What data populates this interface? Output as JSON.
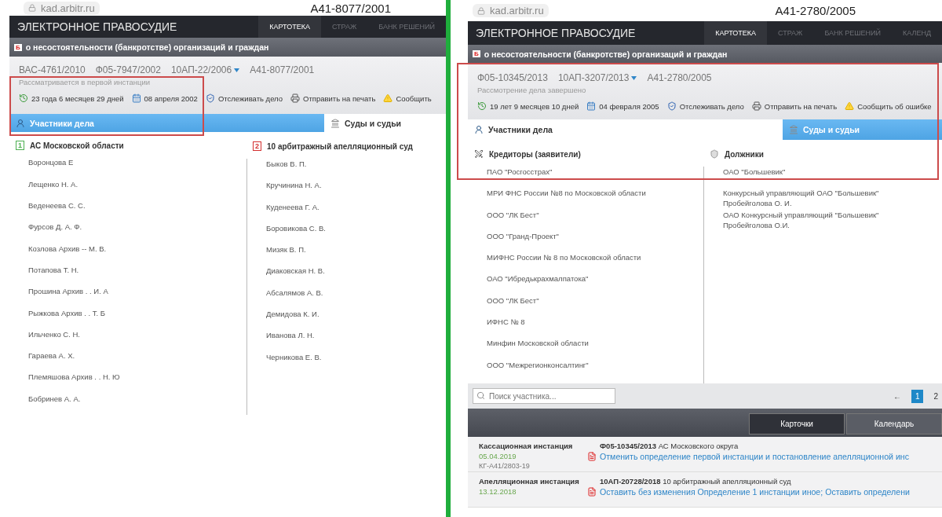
{
  "panels": [
    {
      "address": "kad.arbitr.ru",
      "page_title": "А41-8077/2001",
      "brand": "ЭЛЕКТРОННОЕ ПРАВОСУДИЕ",
      "highlight_frame": true,
      "nav": [
        {
          "label": "КАРТОТЕКА",
          "selected": true
        },
        {
          "label": "СТРАЖ",
          "selected": false
        },
        {
          "label": "БАНК РЕШЕНИЙ",
          "selected": false
        }
      ],
      "category_badge": "Б",
      "category": "о несостоятельности (банкротстве) организаций и граждан",
      "case_numbers": [
        {
          "label": "ВАС-4761/2010",
          "dropdown": false
        },
        {
          "label": "Ф05-7947/2002",
          "dropdown": false
        },
        {
          "label": "10АП-22/2006",
          "dropdown": true
        },
        {
          "label": "А41-8077/2001",
          "dropdown": false
        }
      ],
      "status": "Рассматривается в первой инстанции",
      "actions": [
        {
          "kind": "duration",
          "label": "23 года 6 месяцев 29 дней"
        },
        {
          "kind": "date",
          "label": "08 апреля 2002"
        },
        {
          "kind": "track",
          "label": "Отслеживать дело"
        },
        {
          "kind": "print",
          "label": "Отправить на печать"
        },
        {
          "kind": "report",
          "label": "Сообщить"
        }
      ],
      "tabs": [
        {
          "kind": "participants",
          "label": "Участники дела",
          "selected": true
        },
        {
          "kind": "courts",
          "label": "Суды и судьи",
          "selected": false
        }
      ],
      "columns": [
        {
          "kind": "number",
          "badge": "1",
          "color": "#4caf50",
          "title": "АС Московской области",
          "items": [
            "Воронцова Е",
            "Лещенко Н. А.",
            "Веденеева С. С.",
            "Фурсов Д. А. Ф.",
            "Козлова Архив -- М. В.",
            "Потапова Т. Н.",
            "Прошина Архив . . И. А",
            "Рыжкова Архив . . Т. Б",
            "Ильченко С. Н.",
            "Гараева А. Х.",
            "Племяшова Архив . . Н. Ю",
            "Бобринев А. А."
          ]
        },
        {
          "kind": "number",
          "badge": "2",
          "color": "#d32f2f",
          "title": "10 арбитражный апелляционный суд",
          "items": [
            "Быков В. П.",
            "Кручинина Н. А.",
            "Куденеева Г. А.",
            "Боровикова С. В.",
            "Мизяк В. П.",
            "Диаковская Н. В.",
            "Абсалямов А. В.",
            "Демидова К. И.",
            "Иванова Л. Н.",
            "Черникова Е. В."
          ]
        }
      ]
    },
    {
      "address": "kad.arbitr.ru",
      "page_title": "А41-2780/2005",
      "brand": "ЭЛЕКТРОННОЕ ПРАВОСУДИЕ",
      "highlight_frame": true,
      "nav": [
        {
          "label": "КАРТОТЕКА",
          "selected": true
        },
        {
          "label": "СТРАЖ",
          "selected": false
        },
        {
          "label": "БАНК РЕШЕНИЙ",
          "selected": false
        },
        {
          "label": "КАЛЕНД",
          "selected": false
        }
      ],
      "category_badge": "Б",
      "category": "о несостоятельности (банкротстве) организаций и граждан",
      "case_numbers": [
        {
          "label": "Ф05-10345/2013",
          "dropdown": false
        },
        {
          "label": "10АП-3207/2013",
          "dropdown": true
        },
        {
          "label": "А41-2780/2005",
          "dropdown": false
        }
      ],
      "status": "Рассмотрение дела завершено",
      "actions": [
        {
          "kind": "duration",
          "label": "19 лет 9 месяцев 10 дней"
        },
        {
          "kind": "date",
          "label": "04 февраля 2005"
        },
        {
          "kind": "track",
          "label": "Отслеживать дело"
        },
        {
          "kind": "print",
          "label": "Отправить на печать"
        },
        {
          "kind": "report",
          "label": "Сообщить об ошибке"
        }
      ],
      "tabs": [
        {
          "kind": "participants",
          "label": "Участники дела",
          "selected": false
        },
        {
          "kind": "courts",
          "label": "Суды и судьи",
          "selected": true
        }
      ],
      "columns": [
        {
          "kind": "creditors",
          "title": "Кредиторы (заявители)",
          "items": [
            "ПАО \"Росгосстрах\"",
            "МРИ ФНС России №8 по Московской области",
            "ООО \"ЛК Бест\"",
            "ООО \"Гранд-Проект\"",
            "МИФНС России № 8 по Московской области",
            "ОАО \"Ибредькрахмалпатока\"",
            "ООО \"ЛК Бест\"",
            "ИФНС № 8",
            "Минфин Московской области",
            "ООО \"Межрегионконсалтинг\""
          ]
        },
        {
          "kind": "debtors",
          "title": "Должники",
          "items": [
            "ОАО \"Большевик\"",
            "Конкурсный управляющий ОАО \"Большевик\" Пробейголова О. И.",
            "ОАО Конкурсный управляющий \"Большевик\" Пробейголова О.И."
          ]
        }
      ],
      "search": {
        "placeholder": "Поиск участника..."
      },
      "pagination": [
        {
          "label": "←",
          "selected": false
        },
        {
          "label": "1",
          "selected": true
        },
        {
          "label": "2",
          "selected": false
        }
      ],
      "views": [
        {
          "label": "Карточки",
          "selected": true
        },
        {
          "label": "Календарь",
          "selected": false
        }
      ],
      "instances": [
        {
          "instance": "Кассационная инстанция",
          "date": "05.04.2019",
          "number": "КГ-А41/2803-19",
          "case": "Ф05-10345/2013",
          "court": "АС Московского округа",
          "decision": "Отменить определение первой инстанции и постановление апелляционной инс"
        },
        {
          "instance": "Апелляционная инстанция",
          "date": "13.12.2018",
          "case": "10АП-20728/2018",
          "court": "10 арбитражный апелляционный суд",
          "decision": "Оставить без изменения Определение 1 инстанции иное; Оставить определени"
        }
      ]
    }
  ]
}
